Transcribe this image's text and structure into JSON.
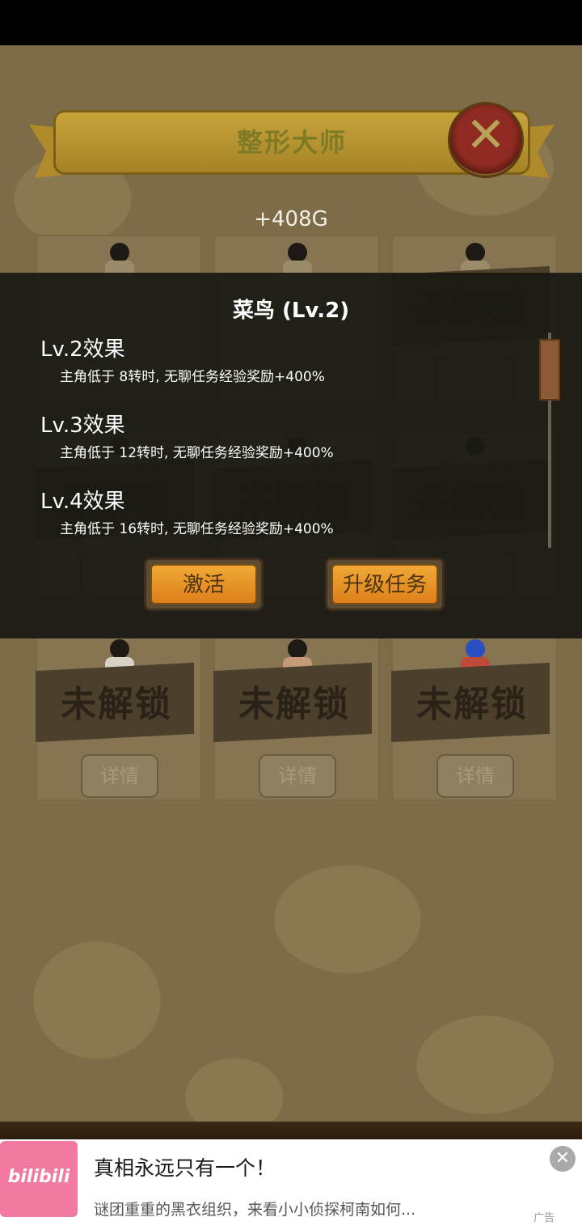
{
  "banner": {
    "title": "整形大师"
  },
  "gold": "+408G",
  "grid": {
    "locked_label": "未解锁",
    "detail_label": "详情",
    "rows": [
      {
        "cells": [
          {
            "state": "hidden"
          },
          {
            "state": "hidden"
          },
          {
            "state": "locked"
          }
        ]
      },
      {
        "cells": [
          {
            "state": "locked"
          },
          {
            "state": "locked"
          },
          {
            "state": "locked"
          }
        ]
      },
      {
        "cells": [
          {
            "state": "locked"
          },
          {
            "state": "locked"
          },
          {
            "state": "locked"
          }
        ]
      }
    ]
  },
  "modal": {
    "title": "菜鸟 (Lv.2)",
    "effects": [
      {
        "title": "Lv.2效果",
        "desc": "主角低于 8转时, 无聊任务经验奖励+400%"
      },
      {
        "title": "Lv.3效果",
        "desc": "主角低于 12转时, 无聊任务经验奖励+400%"
      },
      {
        "title": "Lv.4效果",
        "desc": "主角低于 16转时, 无聊任务经验奖励+400%"
      }
    ],
    "activate_label": "激活",
    "upgrade_label": "升级任务"
  },
  "ad": {
    "logo_text": "bilibili",
    "title": "真相永远只有一个！",
    "desc": "谜团重重的黑衣组织，来看小小侦探柯南如何...",
    "tag": "广告",
    "close_icon": "close-icon"
  },
  "colors": {
    "background": "#7e6c48",
    "banner": "#c8a43c",
    "button_orange": "#e8921f",
    "modal_overlay": "#1c1914"
  }
}
